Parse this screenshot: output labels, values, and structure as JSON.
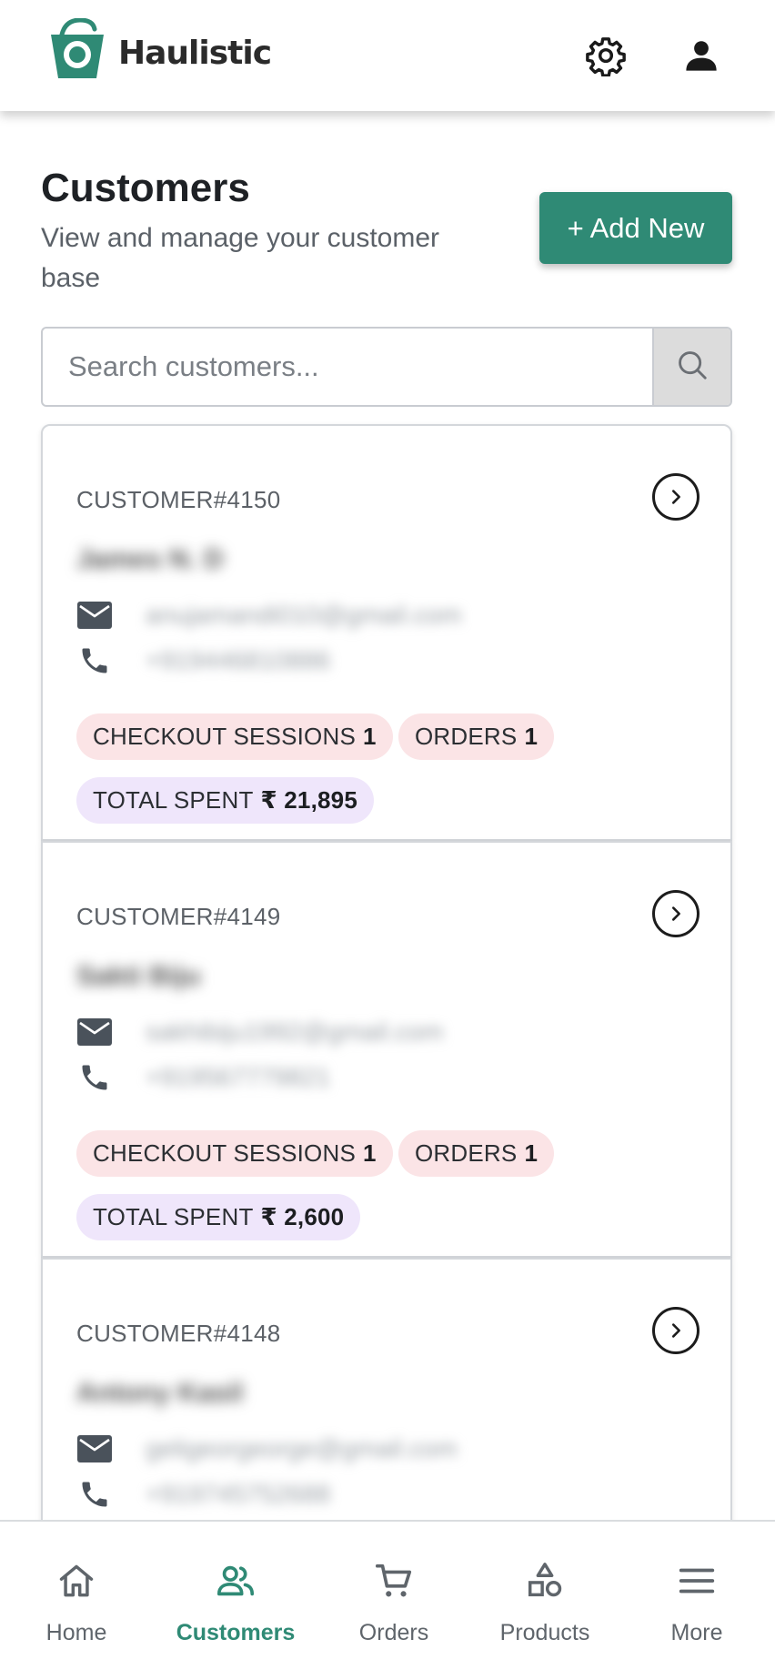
{
  "header": {
    "brand": "Haulistic",
    "logo_color": "#2f8a75",
    "icons": [
      "gear-icon",
      "user-icon"
    ]
  },
  "page": {
    "title": "Customers",
    "subtitle": "View and manage your customer base",
    "add_button": "+ Add New",
    "accent_color": "#2f8a75"
  },
  "search": {
    "placeholder": "Search customers...",
    "icon": "search-icon"
  },
  "customers": [
    {
      "id": "CUSTOMER#4150",
      "name": "James N. D",
      "email": "anujamandi010@gmail.com",
      "phone": "+919446810886",
      "checkout_label": "CHECKOUT SESSIONS",
      "checkout_value": "1",
      "orders_label": "ORDERS",
      "orders_value": "1",
      "spent_label": "TOTAL SPENT",
      "spent_value": "₹ 21,895"
    },
    {
      "id": "CUSTOMER#4149",
      "name": "Sakti Biju",
      "email": "sakhibiju1992@gmail.com",
      "phone": "+919567779821",
      "checkout_label": "CHECKOUT SESSIONS",
      "checkout_value": "1",
      "orders_label": "ORDERS",
      "orders_value": "1",
      "spent_label": "TOTAL SPENT",
      "spent_value": "₹ 2,600"
    },
    {
      "id": "CUSTOMER#4148",
      "name": "Antony Kasil",
      "email": "geligeorgeorge@gmail.com",
      "phone": "+919745752688"
    }
  ],
  "bottom_nav": [
    {
      "label": "Home",
      "icon": "home-icon",
      "active": false
    },
    {
      "label": "Customers",
      "icon": "users-icon",
      "active": true
    },
    {
      "label": "Orders",
      "icon": "cart-icon",
      "active": false
    },
    {
      "label": "Products",
      "icon": "shapes-icon",
      "active": false
    },
    {
      "label": "More",
      "icon": "menu-icon",
      "active": false
    }
  ]
}
